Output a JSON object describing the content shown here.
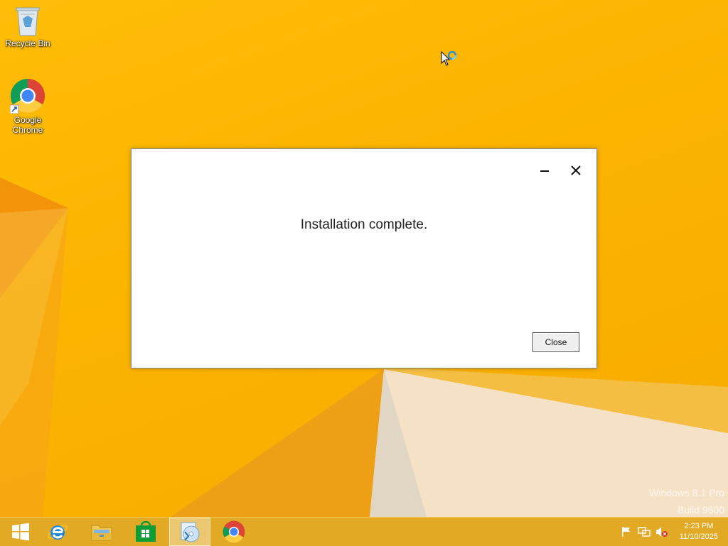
{
  "desktop": {
    "icons": [
      {
        "label": "Recycle Bin"
      },
      {
        "label": "Google\nChrome"
      }
    ],
    "watermark_line1": "Windows 8.1 Pro",
    "watermark_line2": "Build 9600"
  },
  "dialog": {
    "message": "Installation complete.",
    "close_button_label": "Close",
    "minimize_icon": "minimize-icon",
    "close_icon": "close-icon"
  },
  "taskbar": {
    "items": [
      {
        "name": "start-button",
        "icon": "windows-logo-icon"
      },
      {
        "name": "internet-explorer",
        "icon": "internet-explorer-icon"
      },
      {
        "name": "file-explorer",
        "icon": "file-explorer-icon"
      },
      {
        "name": "store",
        "icon": "store-icon"
      },
      {
        "name": "installer",
        "icon": "installer-disc-icon",
        "active": true
      },
      {
        "name": "google-chrome",
        "icon": "chrome-icon"
      }
    ],
    "tray": [
      "flag-icon",
      "network-icon",
      "speaker-muted-icon"
    ],
    "time": "2:23 PM",
    "date": "11/10/2025"
  },
  "colors": {
    "wallpaper": "#f9b200",
    "taskbar": "#e0a828",
    "dialog_bg": "#ffffff"
  }
}
